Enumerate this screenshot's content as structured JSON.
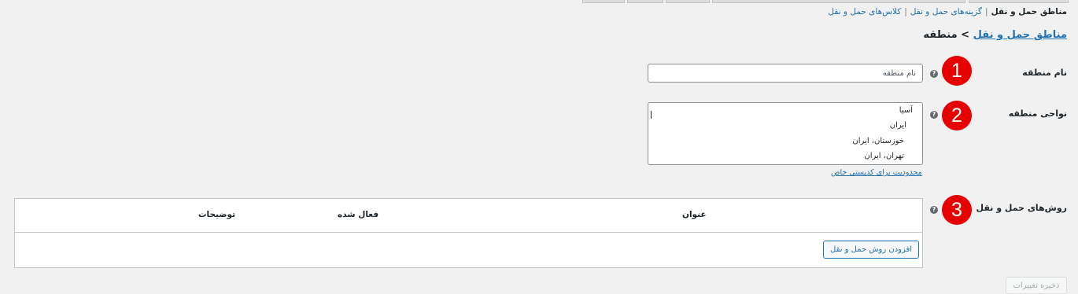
{
  "subnav": {
    "zones": "مناطق حمل و نقل",
    "options": "گزینه‌های حمل و نقل",
    "classes": "کلاس‌های حمل و نقل"
  },
  "breadcrumb": {
    "parent": "مناطق حمل و نقل",
    "separator": ">",
    "current": "منطقه"
  },
  "zone_name": {
    "label": "نام منطقه",
    "placeholder": "نام منطقه"
  },
  "zone_regions": {
    "label": "نواحی منطقه",
    "items": [
      "آسیا",
      "ایران",
      "خوزستان، ایران",
      "تهران، ایران"
    ],
    "limit_link": "محدودیت برای کدپستی خاص"
  },
  "shipping_methods": {
    "label": "روش‌های حمل و نقل",
    "columns": {
      "title": "عنوان",
      "enabled": "فعال شده",
      "description": "توضیحات"
    },
    "add_button": "افزودن روش حمل و نقل"
  },
  "save_button": "ذخیره تغییرات",
  "markers": [
    "1",
    "2",
    "3"
  ],
  "help_icon": "?",
  "colors": {
    "link": "#2271b1",
    "marker": "#e60000",
    "background": "#f1f1f1"
  }
}
